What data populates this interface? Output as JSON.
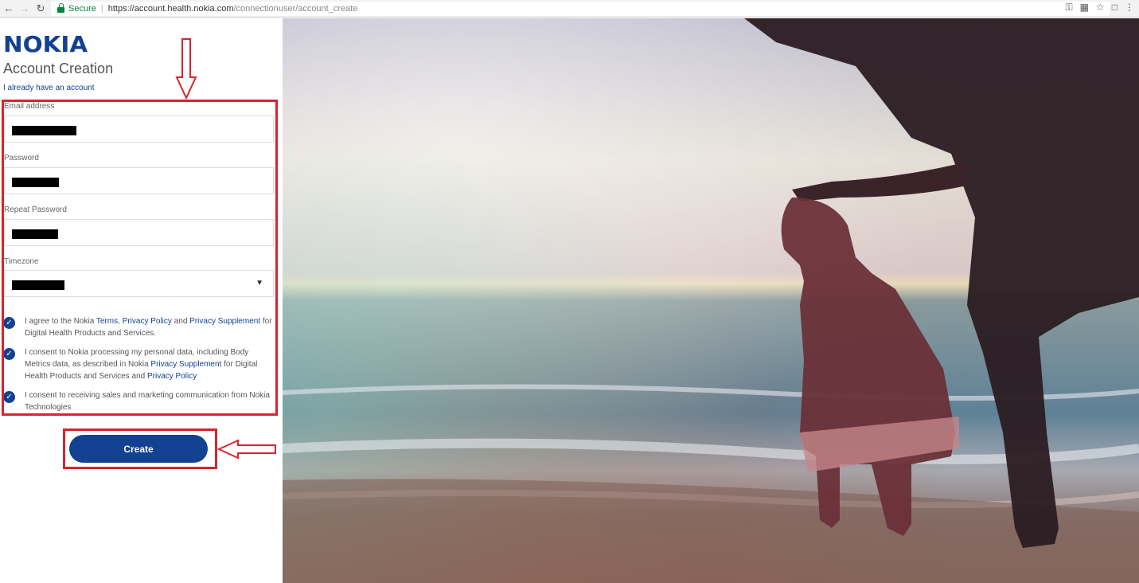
{
  "browser": {
    "secure_label": "Secure",
    "url_host": "https://account.health.nokia.com",
    "url_path": "/connectionuser/account_create"
  },
  "brand": {
    "logo_text": "NOKIA",
    "color": "#124191"
  },
  "form": {
    "title": "Account Creation",
    "have_account_link": "I already have an account",
    "fields": {
      "email_label": "Email address",
      "password_label": "Password",
      "repeat_password_label": "Repeat Password",
      "timezone_label": "Timezone"
    },
    "consents": [
      {
        "p1": "I agree to the Nokia ",
        "l1": "Terms",
        "p2": ", ",
        "l2": "Privacy Policy",
        "p3": " and ",
        "l3": "Privacy Supplement",
        "p4": " for Digital Health Products and Services."
      },
      {
        "p1": "I consent to Nokia processing my personal data, including Body Metrics data, as described in Nokia ",
        "l1": "Privacy Supplement",
        "p2": " for Digital Health Products and Services and ",
        "l2": "Privacy Policy"
      },
      {
        "p1": "I consent to receiving sales and marketing communication from Nokia Technologies"
      }
    ],
    "create_label": "Create"
  },
  "annotation_color": "#d9232d"
}
